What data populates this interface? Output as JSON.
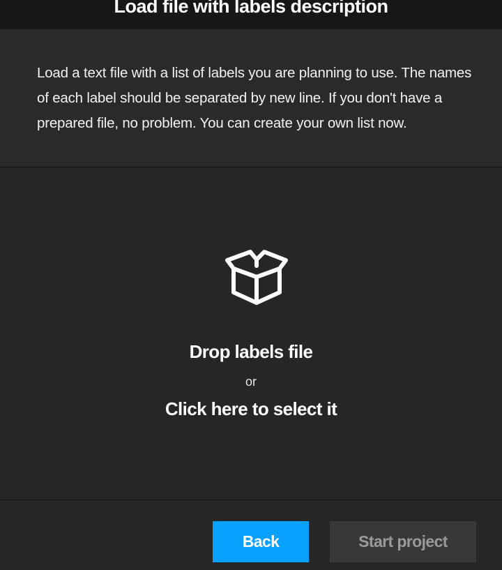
{
  "header": {
    "title": "Load file with labels description"
  },
  "description": {
    "text": "Load a text file with a list of labels you are planning to use. The names of each label should be separated by new line. If you don't have a prepared file, no problem. You can create your own list now."
  },
  "dropzone": {
    "icon": "open-box-icon",
    "title": "Drop labels file",
    "or": "or",
    "click_text": "Click here to select it"
  },
  "footer": {
    "back_label": "Back",
    "start_label": "Start project"
  },
  "colors": {
    "accent": "#08a1ff",
    "background": "#262626",
    "header_bg": "#171717",
    "disabled_button": "#383838"
  }
}
